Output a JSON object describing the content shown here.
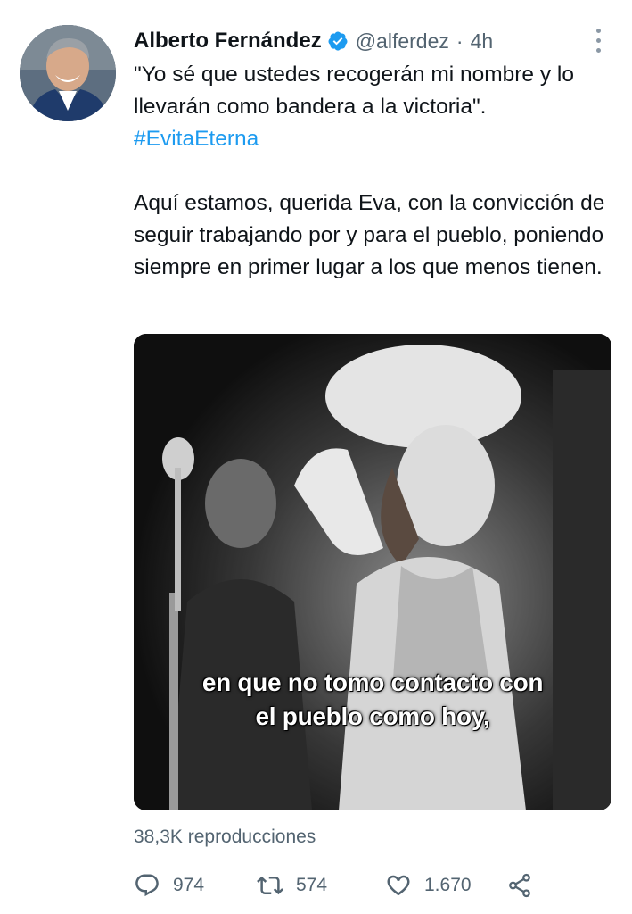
{
  "user": {
    "name": "Alberto Fernández",
    "handle": "@alferdez",
    "separator": "·",
    "time": "4h"
  },
  "tweet": {
    "quote": "\"Yo sé que ustedes recogerán mi nombre y lo llevarán como bandera a la victoria\".",
    "hashtag": "#EvitaEterna",
    "paragraph": "Aquí estamos, querida Eva, con la convicción de seguir trabajando por y para el pueblo, poniendo siempre en primer lugar a los que menos tienen."
  },
  "media": {
    "subtitle_line1": "en que no tomo contacto con",
    "subtitle_line2": "el pueblo como hoy,"
  },
  "stats": {
    "views": "38,3K reproducciones",
    "replies": "974",
    "retweets": "574",
    "likes": "1.670"
  },
  "colors": {
    "accent": "#1d9bf0",
    "secondary_text": "#536471"
  },
  "icons": [
    "verified-badge-icon",
    "more-icon",
    "reply-icon",
    "retweet-icon",
    "like-icon",
    "share-icon"
  ]
}
